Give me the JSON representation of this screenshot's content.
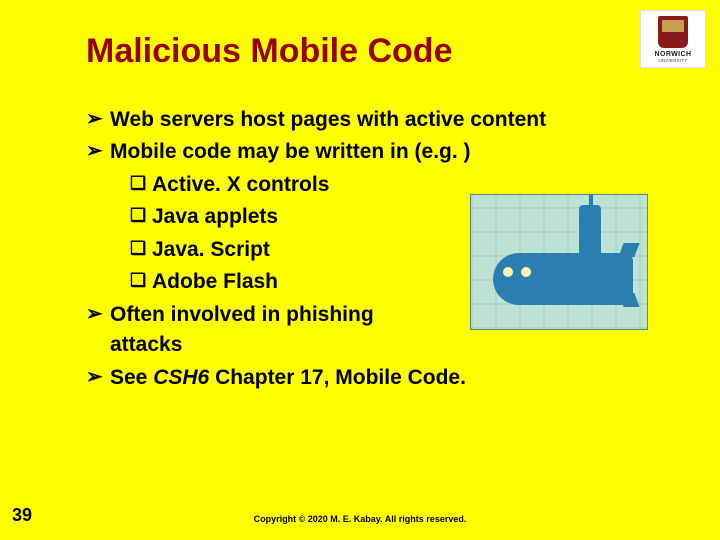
{
  "logo": {
    "name": "NORWICH",
    "sub": "UNIVERSITY"
  },
  "title": "Malicious Mobile Code",
  "bullets": {
    "b1": "Web servers host pages with active content",
    "b2": "Mobile code may be written in (e.g. )",
    "s1": "Active. X controls",
    "s2": "Java applets",
    "s3": "Java. Script",
    "s4": "Adobe Flash",
    "b3": "Often involved in phishing attacks",
    "b4_pre": "See ",
    "b4_ital": "CSH6",
    "b4_post": " Chapter 17, Mobile Code."
  },
  "markers": {
    "arrow": "➢",
    "square": "❑"
  },
  "pageNumber": "39",
  "copyright": "Copyright © 2020 M. E. Kabay. All rights reserved."
}
